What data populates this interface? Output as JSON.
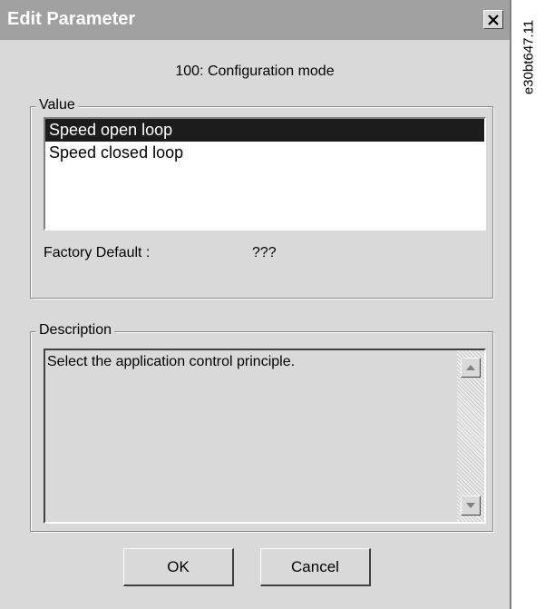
{
  "window": {
    "title": "Edit Parameter",
    "close_label": "×"
  },
  "parameter": {
    "title": "100: Configuration mode"
  },
  "value_group": {
    "legend": "Value",
    "options": [
      "Speed open loop",
      "Speed closed loop"
    ],
    "selected": "Speed open loop",
    "factory_default_label": "Factory Default :",
    "factory_default_value": "???"
  },
  "description_group": {
    "legend": "Description",
    "text": "Select the application control principle."
  },
  "buttons": {
    "ok": "OK",
    "cancel": "Cancel"
  },
  "figure_code": "e30bt647.11",
  "colors": {
    "titlebar": "#a0a0a0",
    "dialog_bg": "#d9d9d9",
    "selection_bg": "#1c1c1c"
  }
}
